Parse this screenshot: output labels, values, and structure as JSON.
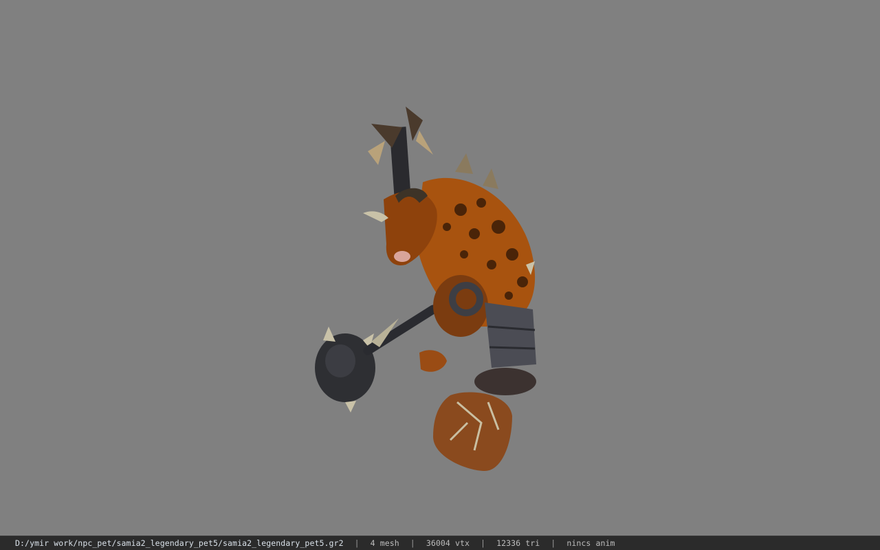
{
  "viewport": {
    "background_color": "#808080",
    "model_subject": "orange spotted minotaur-like creature holding a spiked mace"
  },
  "status_bar": {
    "file_path": "D:/ymir work/npc_pet/samia2_legendary_pet5/samia2_legendary_pet5.gr2",
    "separator": "|",
    "mesh_count": "4 mesh",
    "vertex_count": "36004 vtx",
    "triangle_count": "12336 tri",
    "animation_status": "nincs anim"
  }
}
